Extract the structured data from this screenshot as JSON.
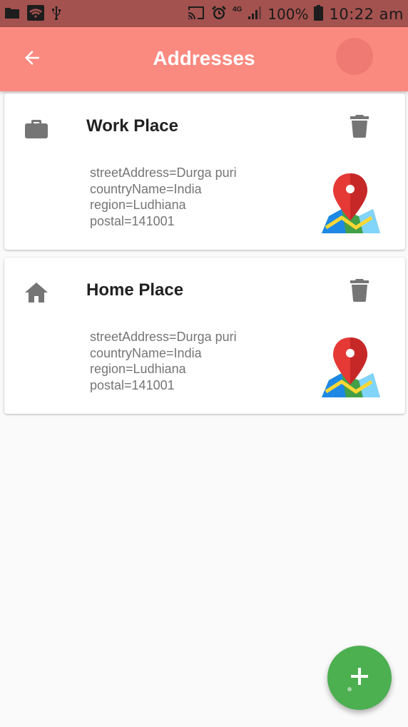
{
  "status_bar": {
    "network_label": "4G",
    "battery_text": "100%",
    "time": "10:22 am",
    "icons": [
      "folder-icon",
      "wifi-icon",
      "usb-icon",
      "cast-icon",
      "alarm-icon",
      "signal-icon",
      "battery-icon"
    ]
  },
  "app_bar": {
    "title": "Addresses",
    "back_icon": "arrow-back-icon",
    "color": "#fa8a80"
  },
  "addresses": [
    {
      "title": "Work Place",
      "icon": "briefcase-icon",
      "lines": [
        "streetAddress=Durga puri",
        "countryName=India",
        "region=Ludhiana",
        "postal=141001"
      ]
    },
    {
      "title": "Home Place",
      "icon": "home-icon",
      "lines": [
        "streetAddress=Durga puri",
        "countryName=India",
        "region=Ludhiana",
        "postal=141001"
      ]
    }
  ],
  "fab": {
    "icon": "plus-icon",
    "color": "#4caf50"
  }
}
